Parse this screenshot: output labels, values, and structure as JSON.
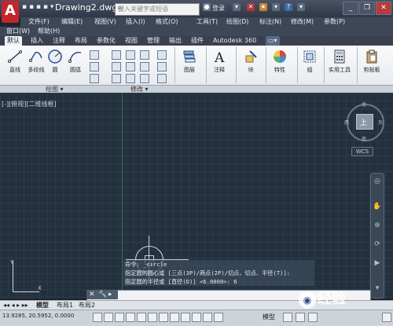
{
  "app_logo": "A",
  "window": {
    "title": "Drawing2.dwg",
    "search_placeholder": "键入关键字或短语",
    "login": "登录",
    "minimize": "_",
    "restore": "❐",
    "close": "✕"
  },
  "menu": {
    "row1": [
      "文件(F)",
      "编辑(E)",
      "视图(V)",
      "插入(I)",
      "格式(O)",
      "工具(T)",
      "绘图(D)",
      "标注(N)",
      "修改(M)",
      "参数(P)"
    ],
    "row2": [
      "窗口(W)",
      "帮助(H)"
    ]
  },
  "ribbon_tabs": [
    "默认",
    "插入",
    "注释",
    "布局",
    "参数化",
    "视图",
    "管理",
    "输出",
    "插件",
    "Autodesk 360"
  ],
  "ribbon": {
    "draw_tools": [
      "直线",
      "多段线",
      "圆",
      "圆弧"
    ],
    "big_tools": [
      "图层",
      "注释",
      "块",
      "特性",
      "组",
      "实用工具",
      "剪贴板"
    ],
    "panels": {
      "draw": "绘图 ▾",
      "modify": "修改 ▾"
    }
  },
  "viewport_label": "[-][俯视][二维线框]",
  "viewcube": {
    "top": "上",
    "north": "北",
    "south": "南",
    "east": "东",
    "west": "西",
    "wcs": "WCS"
  },
  "command": {
    "history": [
      "命令: _circle",
      "指定圆的圆心或 [三点(3P)/两点(2P)/切点、切点、半径(T)]:",
      "指定圆的半径或 [直径(D)] <6.0000>: 6"
    ],
    "prompt_icon": "▸"
  },
  "ucs": {
    "x": "X",
    "y": "Y"
  },
  "layout_tabs": [
    "模型",
    "布局1",
    "布局2"
  ],
  "status": {
    "coords": "13.9285, 20.5952, 0.0000",
    "model": "模型"
  },
  "watermark": "经验"
}
